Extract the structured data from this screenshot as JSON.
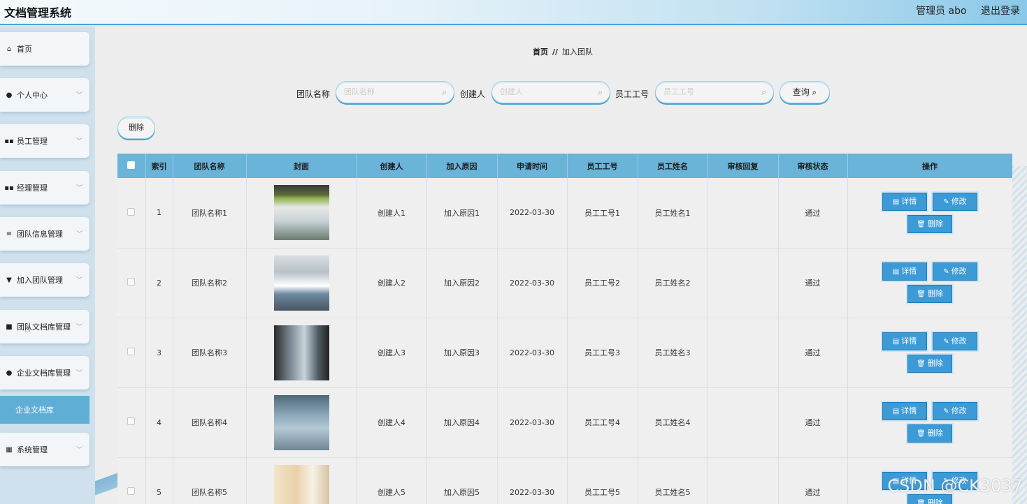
{
  "header": {
    "app_title": "文档管理系统",
    "user_label": "管理员 abo",
    "logout_label": "退出登录"
  },
  "sidebar": {
    "items": [
      {
        "label": "首页",
        "icon": "home-icon",
        "glyph": "⌂",
        "expandable": false
      },
      {
        "label": "个人中心",
        "icon": "user-icon",
        "glyph": "●",
        "expandable": true
      },
      {
        "label": "员工管理",
        "icon": "grid-icon",
        "glyph": "▪▪",
        "expandable": true
      },
      {
        "label": "经理管理",
        "icon": "grid-icon",
        "glyph": "▪▪",
        "expandable": true
      },
      {
        "label": "团队信息管理",
        "icon": "sliders-icon",
        "glyph": "≡",
        "expandable": true
      },
      {
        "label": "加入团队管理",
        "icon": "pin-icon",
        "glyph": "▼",
        "expandable": true
      },
      {
        "label": "团队文档库管理",
        "icon": "video-icon",
        "glyph": "■",
        "expandable": true
      },
      {
        "label": "企业文档库管理",
        "icon": "person-icon",
        "glyph": "●",
        "expandable": true
      },
      {
        "label": "系统管理",
        "icon": "apps-icon",
        "glyph": "▦",
        "expandable": true
      }
    ],
    "sub_item": "企业文档库"
  },
  "breadcrumb": {
    "home": "首页",
    "sep": "//",
    "current": "加入团队"
  },
  "search": {
    "team_name_label": "团队名称",
    "team_name_placeholder": "团队名称",
    "creator_label": "创建人",
    "creator_placeholder": "创建人",
    "emp_no_label": "员工工号",
    "emp_no_placeholder": "员工工号",
    "query_label": "查询"
  },
  "toolbar": {
    "delete_label": "删除"
  },
  "table": {
    "columns": [
      "索引",
      "团队名称",
      "封面",
      "创建人",
      "加入原因",
      "申请时间",
      "员工工号",
      "员工姓名",
      "审核回复",
      "审核状态",
      "操作"
    ],
    "rows": [
      {
        "index": "1",
        "team": "团队名称1",
        "creator": "创建人1",
        "reason": "加入原因1",
        "time": "2022-03-30",
        "emp_no": "员工工号1",
        "emp_name": "员工姓名1",
        "reply": "",
        "status": "通过"
      },
      {
        "index": "2",
        "team": "团队名称2",
        "creator": "创建人2",
        "reason": "加入原因2",
        "time": "2022-03-30",
        "emp_no": "员工工号2",
        "emp_name": "员工姓名2",
        "reply": "",
        "status": "通过"
      },
      {
        "index": "3",
        "team": "团队名称3",
        "creator": "创建人3",
        "reason": "加入原因3",
        "time": "2022-03-30",
        "emp_no": "员工工号3",
        "emp_name": "员工姓名3",
        "reply": "",
        "status": "通过"
      },
      {
        "index": "4",
        "team": "团队名称4",
        "creator": "创建人4",
        "reason": "加入原因4",
        "time": "2022-03-30",
        "emp_no": "员工工号4",
        "emp_name": "员工姓名4",
        "reply": "",
        "status": "通过"
      },
      {
        "index": "5",
        "team": "团队名称5",
        "creator": "创建人5",
        "reason": "加入原因5",
        "time": "2022-03-30",
        "emp_no": "员工工号5",
        "emp_name": "员工姓名5",
        "reply": "",
        "status": "通过"
      }
    ],
    "actions": {
      "detail": "详情",
      "edit": "修改",
      "delete": "删除"
    }
  },
  "watermark": "CSDN @CK3037",
  "colors": {
    "accent": "#3c9bd6",
    "header_bg": "#6ab3d9",
    "sidebar_bg": "#cfe1ec",
    "active_sub": "#5eaed6"
  }
}
